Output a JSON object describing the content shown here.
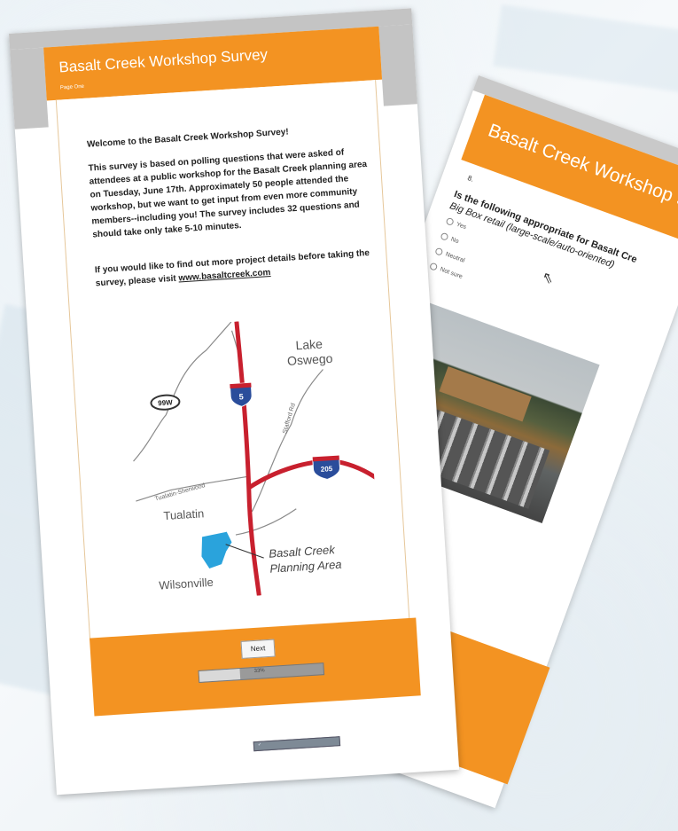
{
  "page_two": {
    "header_title": "Basalt Creek Workshop Su",
    "question_number": "8.",
    "question_line1": "Is the following appropriate for Basalt Cre",
    "question_line2": "Big Box retail (large-scale/auto-oriented)",
    "options": [
      "Yes",
      "No",
      "Neutral",
      "Not sure"
    ]
  },
  "page_one": {
    "header_title": "Basalt Creek Workshop Survey",
    "header_subtitle": "Page One",
    "welcome": "Welcome to the Basalt Creek Workshop Survey!",
    "paragraph1": "This survey is based on polling questions that were asked of attendees at a public workshop for the Basalt Creek planning area on Tuesday, June 17th. Approximately 50 people attended the workshop, but we want to get input from even more community members--including you! The survey includes 32 questions and should take only take 5-10 minutes.",
    "paragraph2_text": "If you would like to find out more project details before taking the survey, please visit ",
    "paragraph2_link": "www.basaltcreek.com",
    "map": {
      "highway_99w": "99W",
      "interstate_5": "5",
      "interstate_205": "205",
      "lake_oswego_line1": "Lake",
      "lake_oswego_line2": "Oswego",
      "stafford_rd": "Stafford Rd",
      "tualatin_sherwood": "Tualatin-Sherwood",
      "tualatin": "Tualatin",
      "wilsonville": "Wilsonville",
      "planning_area_line1": "Basalt Creek",
      "planning_area_line2": "Planning Area"
    },
    "next_label": "Next",
    "progress_percent": 33,
    "progress_label": "33%"
  },
  "colors": {
    "survey_orange": "#f39322",
    "interstate_red": "#c8202e",
    "planning_blue": "#2aa3dc",
    "interstate_shield": "#2a4d9b"
  }
}
